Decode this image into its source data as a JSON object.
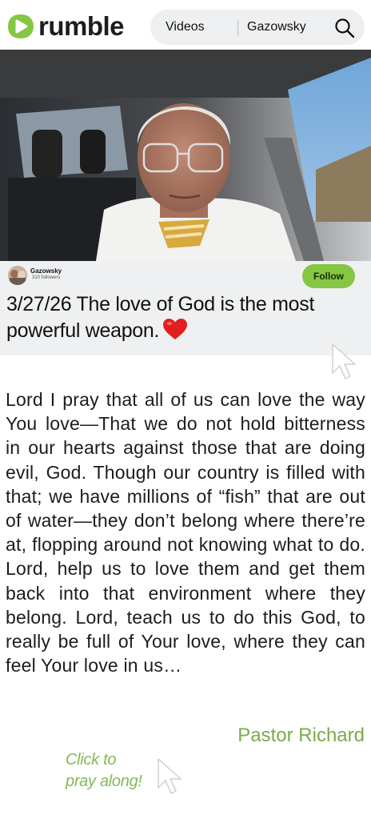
{
  "header": {
    "logo_text": "rumble",
    "nav_videos": "Videos",
    "nav_channel": "Gazowsky",
    "search_icon": "search-icon",
    "brand_color": "#85c742"
  },
  "video": {
    "thumbnail": "video-frame"
  },
  "channel": {
    "name": "Gazowsky",
    "followers": "310 followers",
    "follow_label": "Follow"
  },
  "video_title": "3/27/26 The love of God is the most powerful weapon.",
  "title_icon": "heart-icon",
  "prayer_text": "Lord I pray that all of us can love the way You love—That we do not hold bitterness in our hearts against those that are doing evil, God. Though our country is filled with that; we have millions of “fish” that are out of water—they don’t belong where there’re at, flopping around not knowing what to do. Lord, help us to love them and get them back into that environment where they belong. Lord, teach us to do this God, to really be full of Your love, where they can feel Your love in us…",
  "signature": "Pastor Richard",
  "cta": {
    "line1": "Click to",
    "line2": "pray along!"
  }
}
